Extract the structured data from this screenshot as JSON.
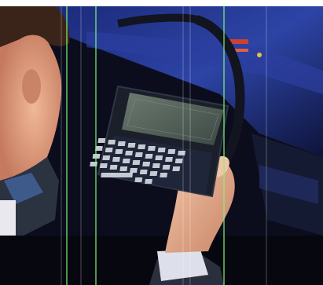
{
  "scene": {
    "subject": "man-holding-handheld-pc-in-car",
    "colors": {
      "background_dark": "#0b0d1c",
      "dashboard_blue": "#1d2f8c",
      "skin": "#e3a383",
      "hair": "#3a2419",
      "jacket": "#2c3340",
      "device_body": "#1a1f2a",
      "device_screen": "#4f5d55",
      "keys": "#c6cbd3",
      "scan_lines": "#7dfb74"
    }
  }
}
